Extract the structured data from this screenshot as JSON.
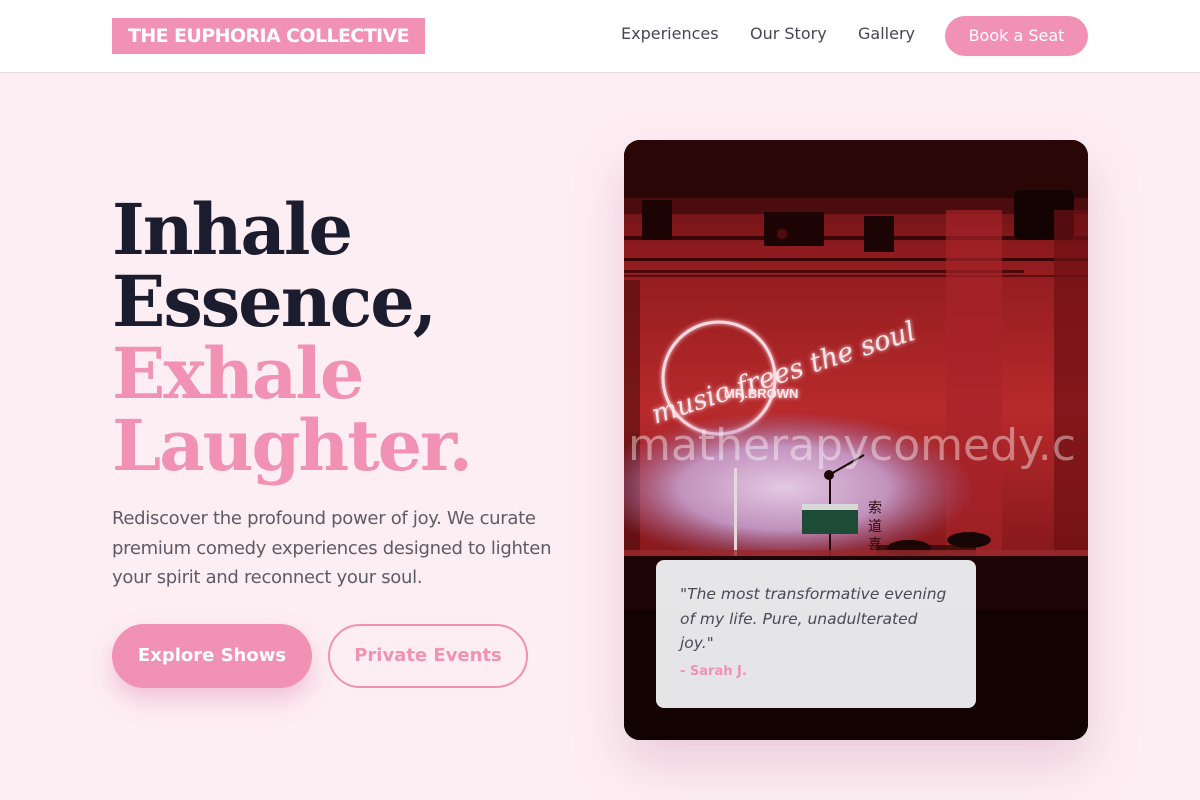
{
  "header": {
    "logo": "THE EUPHORIA COLLECTIVE",
    "nav": [
      "Experiences",
      "Our Story",
      "Gallery"
    ],
    "cta": "Book a Seat"
  },
  "hero": {
    "headline_line1": "Inhale",
    "headline_line2": "Essence,",
    "headline_line3": "Exhale",
    "headline_line4": "Laughter.",
    "lead": "Rediscover the profound power of joy. We curate premium comedy experiences designed to lighten your spirit and reconnect your soul.",
    "primary_button": "Explore Shows",
    "secondary_button": "Private Events"
  },
  "photo": {
    "neon_text": "music frees the soul",
    "neon_subtext": "MR.BROWN",
    "watermark": "matherapycomedy.c",
    "signage_glyphs": "索 道 喜 剧"
  },
  "testimonial": {
    "quote": "\"The most transformative evening of my life. Pure, unadulterated joy.\"",
    "author": "- Sarah J."
  },
  "colors": {
    "accent": "#f191b3",
    "background": "#fdeef3",
    "dark": "#1b1c2e"
  }
}
